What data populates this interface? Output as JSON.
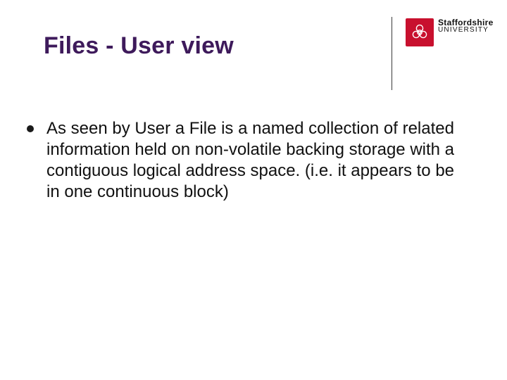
{
  "slide": {
    "title": "Files - User view",
    "logo": {
      "line1": "Staffordshire",
      "line2": "UNIVERSITY"
    },
    "bullets": [
      "As seen by User a File is a named collection of related information held on non-volatile backing storage with a contiguous logical address space. (i.e. it appears to be in one continuous block)"
    ]
  }
}
